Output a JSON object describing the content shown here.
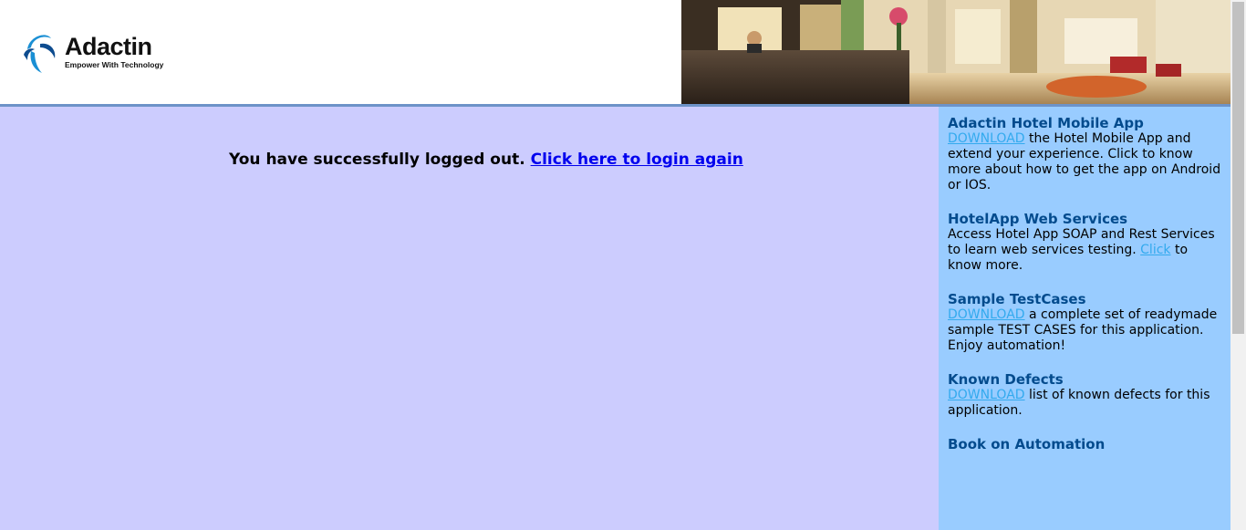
{
  "header": {
    "logo_name": "Adactin",
    "logo_tagline": "Empower With Technology"
  },
  "main": {
    "message": "You have successfully logged out.",
    "login_link": "Click here to login again"
  },
  "sidebar": {
    "mobile": {
      "title": "Adactin Hotel Mobile App",
      "link": "DOWNLOAD",
      "text": " the Hotel Mobile App and extend your experience. Click to know more about how to get the app on Android or IOS."
    },
    "webservices": {
      "title": "HotelApp Web Services",
      "text_before": "Access Hotel App SOAP and Rest Services to learn web services testing. ",
      "link": "Click",
      "text_after": " to know more."
    },
    "testcases": {
      "title": "Sample TestCases",
      "link": "DOWNLOAD",
      "text": " a complete set of readymade sample TEST CASES for this application. Enjoy automation!"
    },
    "defects": {
      "title": "Known Defects",
      "link": "DOWNLOAD",
      "text": " list of known defects for this application."
    },
    "book": {
      "title": "Book on Automation"
    }
  },
  "colors": {
    "main_bg": "#ccccfe",
    "sidebar_bg": "#99ccff",
    "sidebar_title": "#034b8d",
    "sidebar_link": "#33aaee",
    "login_link": "#0000ee"
  }
}
